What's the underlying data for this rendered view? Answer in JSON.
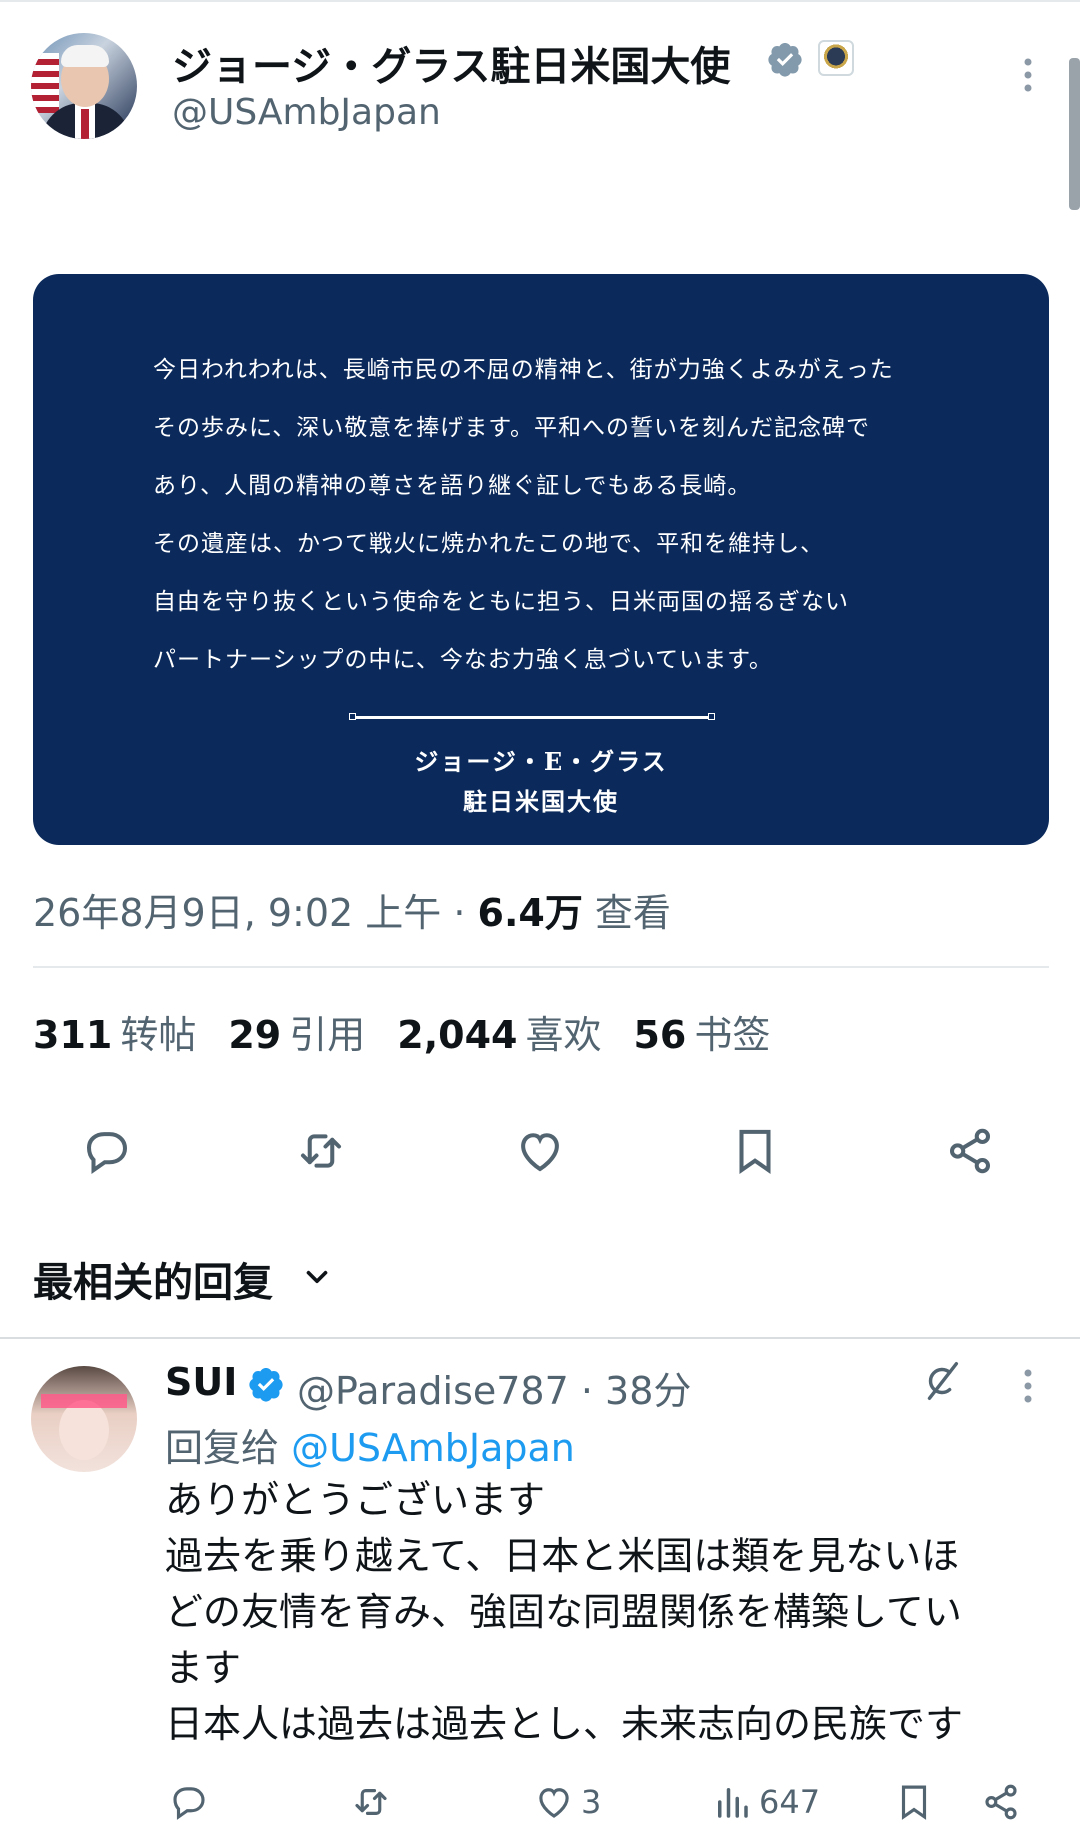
{
  "tweet": {
    "author_name": "ジョージ・グラス駐日米国大使",
    "author_handle": "@USAmbJapan",
    "image_text": {
      "lines": [
        "今日われわれは、長崎市民の不屈の精神と、街が力強くよみがえった",
        "その歩みに、深い敬意を捧げます。平和への誓いを刻んだ記念碑で",
        "あり、人間の精神の尊さを語り継ぐ証しでもある長崎。",
        "その遺産は、かつて戦火に焼かれたこの地で、平和を維持し、",
        "自由を守り抜くという使命をともに担う、日米両国の揺るぎない",
        "パートナーシップの中に、今なお力強く息づいています。"
      ],
      "signature_name": "ジョージ・E・グラス",
      "signature_title": "駐日米国大使"
    },
    "timestamp": "26年8月9日, 9:02 上午 · ",
    "views_count": "6.4万",
    "views_label": " 查看",
    "stats": [
      {
        "count": "311",
        "label": "转帖"
      },
      {
        "count": "29",
        "label": "引用"
      },
      {
        "count": "2,044",
        "label": "喜欢"
      },
      {
        "count": "56",
        "label": "书签"
      }
    ]
  },
  "actions": [
    "reply-icon",
    "retweet-icon",
    "like-icon",
    "bookmark-icon",
    "share-icon"
  ],
  "sort_label": "最相关的回复",
  "reply": {
    "name": "SUI",
    "handle_time": "@Paradise787 · 38分",
    "reply_to_prefix": "回复给 ",
    "reply_to_handle": "@USAmbJapan",
    "text_lines": [
      "ありがとうございます",
      "過去を乗り越えて、日本と米国は類を見ないほ",
      "どの友情を育み、強固な同盟関係を構築してい",
      "ます",
      "日本人は過去は過去とし、未来志向の民族です"
    ],
    "like_count": "3",
    "views_count": "647"
  },
  "colors": {
    "accent": "#1d9bf0",
    "card_bg": "#0b2a5b",
    "secondary_text": "#536471"
  }
}
